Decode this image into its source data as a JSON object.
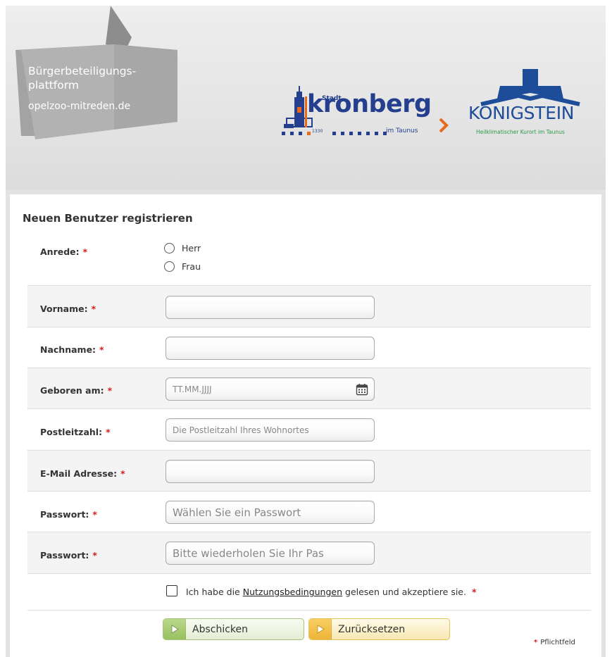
{
  "header": {
    "flag_title_line1": "Bürgerbeteiligungs-",
    "flag_title_line2": "plattform",
    "flag_subtitle": "opelzoo-mitreden.de",
    "kronberg": {
      "stadt": "Stadt",
      "name": "kronberg",
      "year": "1330",
      "region": "im Taunus"
    },
    "koenigstein": {
      "name": "KÖNIGSTEIN",
      "subtitle": "Heilklimatischer Kurort im Taunus"
    }
  },
  "form": {
    "title": "Neuen Benutzer registrieren",
    "required_marker": "*",
    "anrede": {
      "label": "Anrede:",
      "options": [
        "Herr",
        "Frau"
      ]
    },
    "fields": {
      "vorname": {
        "label": "Vorname:",
        "value": "",
        "placeholder": ""
      },
      "nachname": {
        "label": "Nachname:",
        "value": "",
        "placeholder": ""
      },
      "geboren": {
        "label": "Geboren am:",
        "value": "",
        "placeholder": "TT.MM.JJJJ"
      },
      "plz": {
        "label": "Postleitzahl:",
        "value": "",
        "placeholder": "Die Postleitzahl Ihres Wohnortes"
      },
      "email": {
        "label": "E-Mail Adresse:",
        "value": "",
        "placeholder": ""
      },
      "passwort1": {
        "label": "Passwort:",
        "value": "",
        "placeholder": "Wählen Sie ein Passwort"
      },
      "passwort2": {
        "label": "Passwort:",
        "value": "",
        "placeholder": "Bitte wiederholen Sie Ihr Pas"
      }
    },
    "terms": {
      "prefix": "Ich habe die ",
      "link": "Nutzungsbedingungen",
      "suffix": " gelesen und akzeptiere sie."
    },
    "buttons": {
      "submit": "Abschicken",
      "reset": "Zurücksetzen"
    },
    "pflichtfeld": "Pflichtfeld"
  },
  "colors": {
    "required": "#d21f1f",
    "kronberg_blue": "#243f8e",
    "kronberg_orange": "#e8681c",
    "koenigstein_blue": "#1d4c99",
    "koenigstein_green": "#2a9a46",
    "submit_green": "#98c160",
    "reset_yellow": "#eeb438"
  }
}
